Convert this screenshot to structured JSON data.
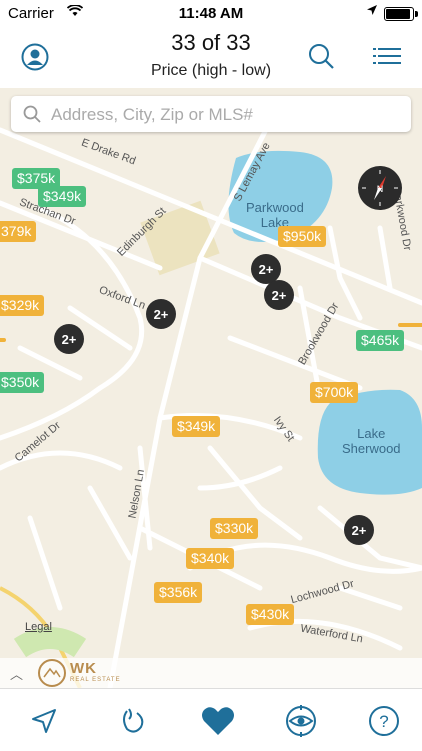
{
  "status_bar": {
    "carrier": "Carrier",
    "time": "11:48 AM",
    "battery_level": 0.95
  },
  "header": {
    "title": "33 of 33",
    "subtitle": "Price (high - low)"
  },
  "search": {
    "placeholder": "Address, City, Zip or MLS#"
  },
  "map": {
    "street_labels": [
      "E Drake Rd",
      "S Lemay Ave",
      "Strachan Dr",
      "Edinburgh St",
      "Oxford Ln",
      "Brookwood Dr",
      "Parkwood Dr",
      "Camelot Dr",
      "Ivy St",
      "Nelson Ln",
      "Lochwood Dr",
      "Waterford Ln"
    ],
    "lakes": [
      {
        "name": "Parkwood\nLake"
      },
      {
        "name": "Lake\nSherwood"
      }
    ],
    "prices": [
      "$375k",
      "$349k",
      "379k",
      "$950k",
      "$329k",
      "$465k",
      "$350k",
      "$700k",
      "$349k",
      "$330k",
      "$340k",
      "$356k",
      "$430k"
    ],
    "clusters": [
      "2+",
      "2+",
      "2+",
      "2+",
      "2+"
    ],
    "legal": "Legal"
  },
  "brand": {
    "name": "WK",
    "tagline": "REAL ESTATE"
  },
  "tabs": [
    "location",
    "draw",
    "favorites",
    "watch",
    "help"
  ],
  "colors": {
    "accent": "#1f6f9a",
    "price_green": "#4cbf7f",
    "price_yellow": "#f0b23a",
    "cluster": "#2d2d2d"
  }
}
